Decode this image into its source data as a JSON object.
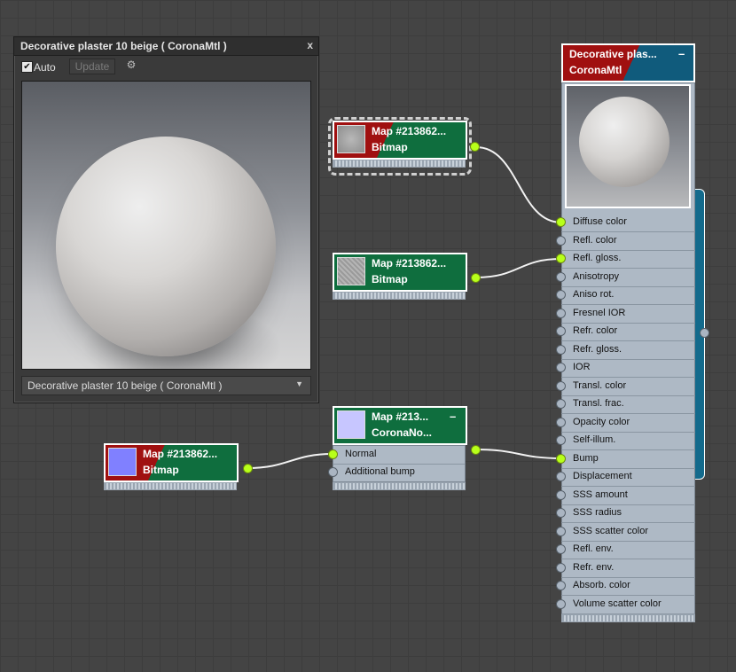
{
  "preview_window": {
    "title": "Decorative plaster 10 beige  ( CoronaMtl )",
    "close_glyph": "x",
    "auto_label": "Auto",
    "auto_checked": true,
    "update_label": "Update",
    "material_select": "Decorative plaster 10 beige  ( CoronaMtl )"
  },
  "nodes": {
    "bitmap_diffuse": {
      "title": "Map #213862...",
      "type": "Bitmap"
    },
    "bitmap_gloss": {
      "title": "Map #213862...",
      "type": "Bitmap"
    },
    "bitmap_normal": {
      "title": "Map #213862...",
      "type": "Bitmap"
    },
    "normal_map": {
      "title": "Map #213...",
      "type": "CoronaNo...",
      "slots": [
        "Normal",
        "Additional bump"
      ]
    },
    "material": {
      "title": "Decorative plas...",
      "type": "CoronaMtl",
      "slots": [
        "Diffuse color",
        "Refl. color",
        "Refl. gloss.",
        "Anisotropy",
        "Aniso rot.",
        "Fresnel IOR",
        "Refr. color",
        "Refr. gloss.",
        "IOR",
        "Transl. color",
        "Transl. frac.",
        "Opacity color",
        "Self-illum.",
        "Bump",
        "Displacement",
        "SSS amount",
        "SSS radius",
        "SSS scatter color",
        "Refl. env.",
        "Refr. env.",
        "Absorb. color",
        "Volume scatter color"
      ],
      "connected_slots": [
        "Diffuse color",
        "Refl. gloss.",
        "Bump"
      ]
    }
  },
  "colors": {
    "canvas": "#444444",
    "node_green": "#0f6e3e",
    "node_red": "#a01010",
    "material_blue": "#105b7c",
    "connected_port": "#b8ff1a",
    "empty_port": "#aab5c2"
  }
}
